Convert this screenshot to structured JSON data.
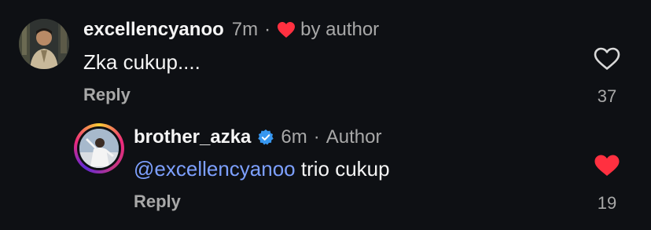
{
  "comments": [
    {
      "username": "excellencyanoo",
      "time": "7m",
      "separator": "·",
      "liked_by_author_label": "by author",
      "text": "Zka cukup....",
      "reply_label": "Reply",
      "likes": "37",
      "liked": false
    },
    {
      "username": "brother_azka",
      "verified": true,
      "time": "6m",
      "separator": "·",
      "author_label": "Author",
      "mention": "@excellencyanoo",
      "text": " trio cukup",
      "reply_label": "Reply",
      "likes": "19",
      "liked": true
    }
  ],
  "colors": {
    "background": "#0e1014",
    "heart_red": "#ff3040",
    "mention_blue": "#7da0ff",
    "verified_blue": "#3797f0",
    "muted_text": "#a8a8a8"
  },
  "icons": [
    "heart-icon",
    "heart-outline-icon",
    "verified-badge-icon"
  ]
}
